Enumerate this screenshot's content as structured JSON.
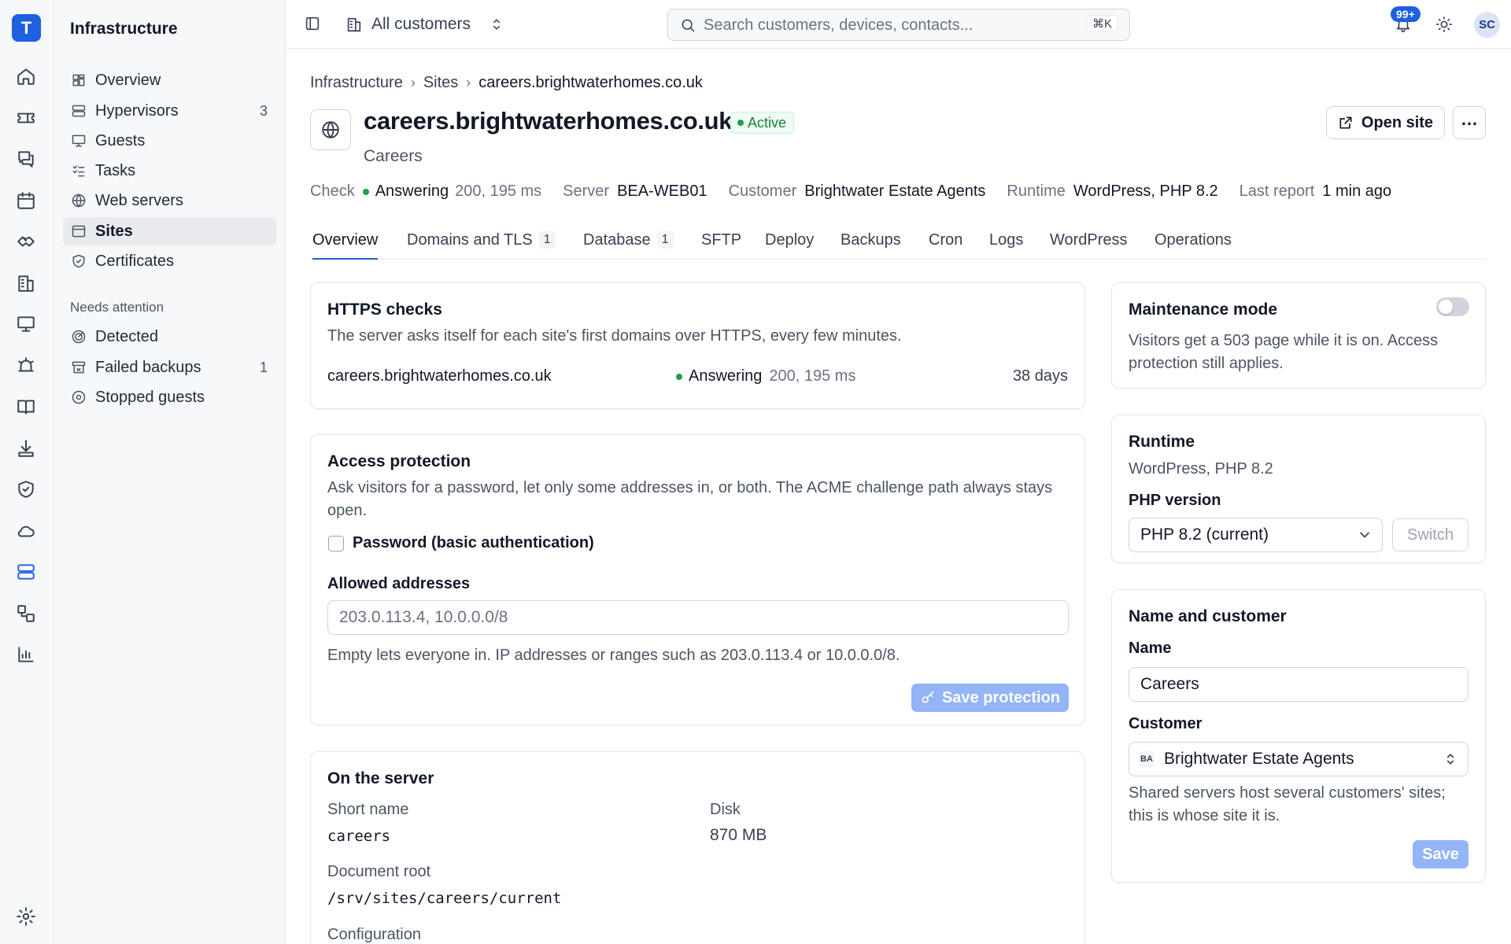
{
  "rail": {
    "logo": "T",
    "icons": [
      "home-icon",
      "ticket-icon",
      "chat-icon",
      "calendar-icon",
      "handshake-icon",
      "building-icon",
      "monitor-icon",
      "alarm-icon",
      "book-icon",
      "download-icon",
      "shield-icon",
      "cloud-icon",
      "server-icon",
      "workflow-icon",
      "chart-icon",
      "settings-icon"
    ]
  },
  "sidenav": {
    "title": "Infrastructure",
    "items": [
      {
        "label": "Overview",
        "count": ""
      },
      {
        "label": "Hypervisors",
        "count": "3"
      },
      {
        "label": "Guests",
        "count": ""
      },
      {
        "label": "Tasks",
        "count": ""
      },
      {
        "label": "Web servers",
        "count": ""
      },
      {
        "label": "Sites",
        "count": ""
      },
      {
        "label": "Certificates",
        "count": ""
      }
    ],
    "section_label": "Needs attention",
    "attention": [
      {
        "label": "Detected",
        "count": ""
      },
      {
        "label": "Failed backups",
        "count": "1"
      },
      {
        "label": "Stopped guests",
        "count": ""
      }
    ]
  },
  "topbar": {
    "customer_select": "All customers",
    "search_placeholder": "Search customers, devices, contacts...",
    "search_shortcut": "⌘K",
    "notifications_badge": "99+",
    "avatar_initials": "SC"
  },
  "breadcrumb": [
    "Infrastructure",
    "Sites",
    "careers.brightwaterhomes.co.uk"
  ],
  "header": {
    "title": "careers.brightwaterhomes.co.uk",
    "status": "Active",
    "subtitle": "Careers",
    "open_site_label": "Open site"
  },
  "meta": {
    "check_key": "Check",
    "check_value": "Answering",
    "check_detail": "200, 195 ms",
    "server_key": "Server",
    "server_value": "BEA-WEB01",
    "customer_key": "Customer",
    "customer_value": "Brightwater Estate Agents",
    "runtime_key": "Runtime",
    "runtime_value": "WordPress, PHP 8.2",
    "report_key": "Last report",
    "report_value": "1 min ago"
  },
  "tabs": [
    {
      "label": "Overview",
      "count": ""
    },
    {
      "label": "Domains and TLS",
      "count": "1"
    },
    {
      "label": "Database",
      "count": "1"
    },
    {
      "label": "SFTP",
      "count": ""
    },
    {
      "label": "Deploy",
      "count": ""
    },
    {
      "label": "Backups",
      "count": ""
    },
    {
      "label": "Cron",
      "count": ""
    },
    {
      "label": "Logs",
      "count": ""
    },
    {
      "label": "WordPress",
      "count": ""
    },
    {
      "label": "Operations",
      "count": ""
    }
  ],
  "https": {
    "title": "HTTPS checks",
    "desc": "The server asks itself for each site's first domains over HTTPS, every few minutes.",
    "domain": "careers.brightwaterhomes.co.uk",
    "status": "Answering",
    "detail": "200, 195 ms",
    "expiry": "38 days"
  },
  "access": {
    "title": "Access protection",
    "desc": "Ask visitors for a password, let only some addresses in, or both. The ACME challenge path always stays open.",
    "password_label": "Password (basic authentication)",
    "allowed_label": "Allowed addresses",
    "allowed_placeholder": "203.0.113.4, 10.0.0.0/8",
    "hint": "Empty lets everyone in. IP addresses or ranges such as 203.0.113.4 or 10.0.0.0/8.",
    "save_label": "Save protection"
  },
  "server": {
    "title": "On the server",
    "short_name_label": "Short name",
    "short_name": "careers",
    "disk_label": "Disk",
    "disk": "870 MB",
    "docroot_label": "Document root",
    "docroot": "/srv/sites/careers/current",
    "config_label": "Configuration"
  },
  "maintenance": {
    "title": "Maintenance mode",
    "enabled": false,
    "desc": "Visitors get a 503 page while it is on. Access protection still applies."
  },
  "runtime": {
    "title": "Runtime",
    "value": "WordPress, PHP 8.2",
    "php_label": "PHP version",
    "php_selected": "PHP 8.2 (current)",
    "switch_label": "Switch"
  },
  "name_customer": {
    "title": "Name and customer",
    "name_label": "Name",
    "name_value": "Careers",
    "customer_label": "Customer",
    "customer_initials": "BA",
    "customer_value": "Brightwater Estate Agents",
    "hint": "Shared servers host several customers' sites; this is whose site it is.",
    "save_label": "Save"
  },
  "colors": {
    "accent": "#1f5fe0",
    "success": "#16a34a",
    "disabled_primary": "#93b4f7"
  }
}
